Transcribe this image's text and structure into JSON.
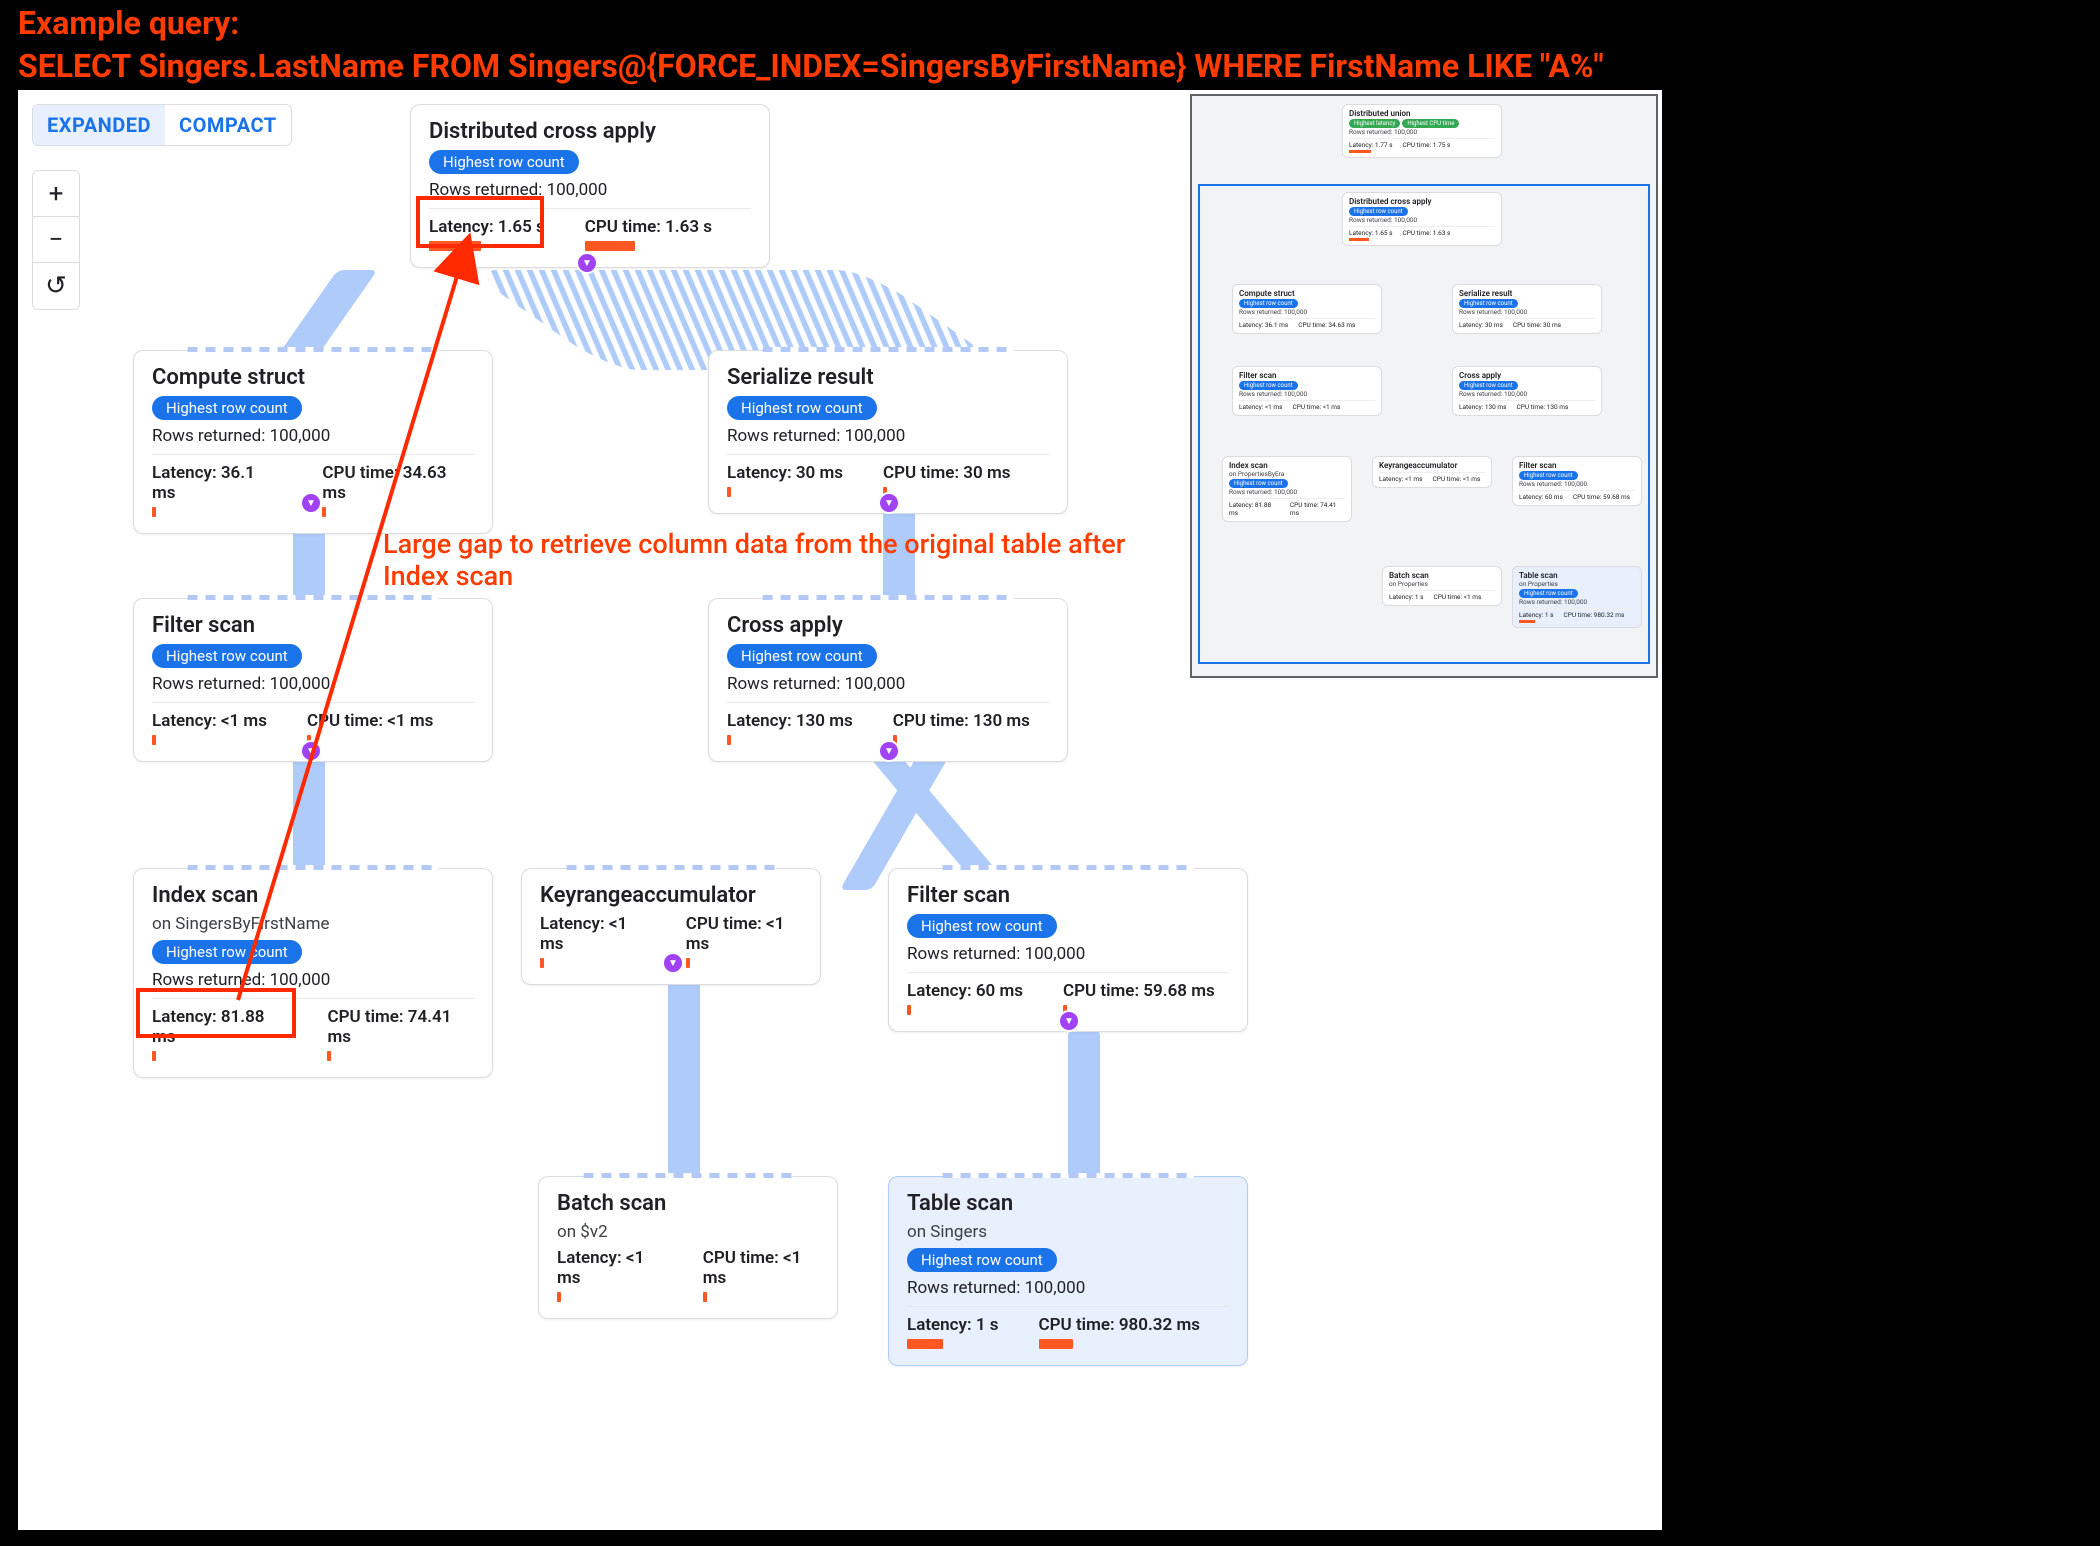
{
  "annotations": {
    "header_line1": "Example query:",
    "header_line2": "SELECT Singers.LastName FROM Singers@{FORCE_INDEX=SingersByFirstName} WHERE FirstName LIKE \"A%\"",
    "mid": "Large gap to retrieve column data from the original table after Index scan"
  },
  "toolbar": {
    "expanded": "EXPANDED",
    "compact": "COMPACT",
    "zoom_in": "+",
    "zoom_out": "−",
    "reset": "↺"
  },
  "badge_text": "Highest row count",
  "nodes": {
    "dca": {
      "title": "Distributed cross apply",
      "rows": "Rows returned: 100,000",
      "latency": "Latency: 1.65 s",
      "cpu": "CPU time: 1.63 s",
      "lat_w": 52,
      "cpu_w": 50
    },
    "cs": {
      "title": "Compute struct",
      "rows": "Rows returned: 100,000",
      "latency": "Latency: 36.1 ms",
      "cpu": "CPU time: 34.63 ms",
      "lat_w": 4,
      "cpu_w": 4
    },
    "sr": {
      "title": "Serialize result",
      "rows": "Rows returned: 100,000",
      "latency": "Latency: 30 ms",
      "cpu": "CPU time: 30 ms",
      "lat_w": 4,
      "cpu_w": 4
    },
    "fs1": {
      "title": "Filter scan",
      "rows": "Rows returned: 100,000",
      "latency": "Latency: <1 ms",
      "cpu": "CPU time: <1 ms",
      "lat_w": 4,
      "cpu_w": 4
    },
    "ca": {
      "title": "Cross apply",
      "rows": "Rows returned: 100,000",
      "latency": "Latency: 130 ms",
      "cpu": "CPU time: 130 ms",
      "lat_w": 4,
      "cpu_w": 4
    },
    "ix": {
      "title": "Index scan",
      "sub": "on SingersByFirstName",
      "rows": "Rows returned: 100,000",
      "latency": "Latency: 81.88 ms",
      "cpu": "CPU time: 74.41 ms",
      "lat_w": 4,
      "cpu_w": 4
    },
    "kra": {
      "title": "Keyrangeaccumulator",
      "latency": "Latency: <1 ms",
      "cpu": "CPU time: <1 ms",
      "lat_w": 4,
      "cpu_w": 4
    },
    "fs2": {
      "title": "Filter scan",
      "rows": "Rows returned: 100,000",
      "latency": "Latency: 60 ms",
      "cpu": "CPU time: 59.68 ms",
      "lat_w": 4,
      "cpu_w": 4
    },
    "bs": {
      "title": "Batch scan",
      "sub": "on $v2",
      "latency": "Latency: <1 ms",
      "cpu": "CPU time: <1 ms",
      "lat_w": 4,
      "cpu_w": 4
    },
    "ts": {
      "title": "Table scan",
      "sub": "on Singers",
      "rows": "Rows returned: 100,000",
      "latency": "Latency: 1 s",
      "cpu": "CPU time: 980.32 ms",
      "lat_w": 36,
      "cpu_w": 34
    }
  },
  "minimap": {
    "du": {
      "title": "Distributed union",
      "rows": "Rows returned: 100,000",
      "latency": "Latency: 1.77 s",
      "cpu": "CPU time: 1.75 s",
      "badge1": "Highest latency",
      "badge2": "Highest CPU time"
    },
    "dca": {
      "title": "Distributed cross apply",
      "rows": "Rows returned: 100,000",
      "latency": "Latency: 1.65 s",
      "cpu": "CPU time: 1.63 s"
    },
    "cs": {
      "title": "Compute struct",
      "rows": "Rows returned: 100,000",
      "latency": "Latency: 36.1 ms",
      "cpu": "CPU time: 34.63 ms"
    },
    "sr": {
      "title": "Serialize result",
      "rows": "Rows returned: 100,000",
      "latency": "Latency: 30 ms",
      "cpu": "CPU time: 30 ms"
    },
    "fs1": {
      "title": "Filter scan",
      "rows": "Rows returned: 100,000",
      "latency": "Latency: <1 ms",
      "cpu": "CPU time: <1 ms"
    },
    "ca": {
      "title": "Cross apply",
      "rows": "Rows returned: 100,000",
      "latency": "Latency: 130 ms",
      "cpu": "CPU time: 130 ms"
    },
    "ix": {
      "title": "Index scan",
      "sub": "on PropertiesByEra",
      "rows": "Rows returned: 100,000",
      "latency": "Latency: 81.88 ms",
      "cpu": "CPU time: 74.41 ms"
    },
    "kra": {
      "title": "Keyrangeaccumulator",
      "latency": "Latency: <1 ms",
      "cpu": "CPU time: <1 ms"
    },
    "fs2": {
      "title": "Filter scan",
      "rows": "Rows returned: 100,000",
      "latency": "Latency: 60 ms",
      "cpu": "CPU time: 59.68 ms"
    },
    "bs": {
      "title": "Batch scan",
      "sub": "on Properties",
      "latency": "Latency: 1 s",
      "cpu": "CPU time: <1 ms"
    },
    "ts": {
      "title": "Table scan",
      "sub": "on Properties",
      "rows": "Rows returned: 100,000",
      "latency": "Latency: 1 s",
      "cpu": "CPU time: 980.32 ms"
    }
  }
}
